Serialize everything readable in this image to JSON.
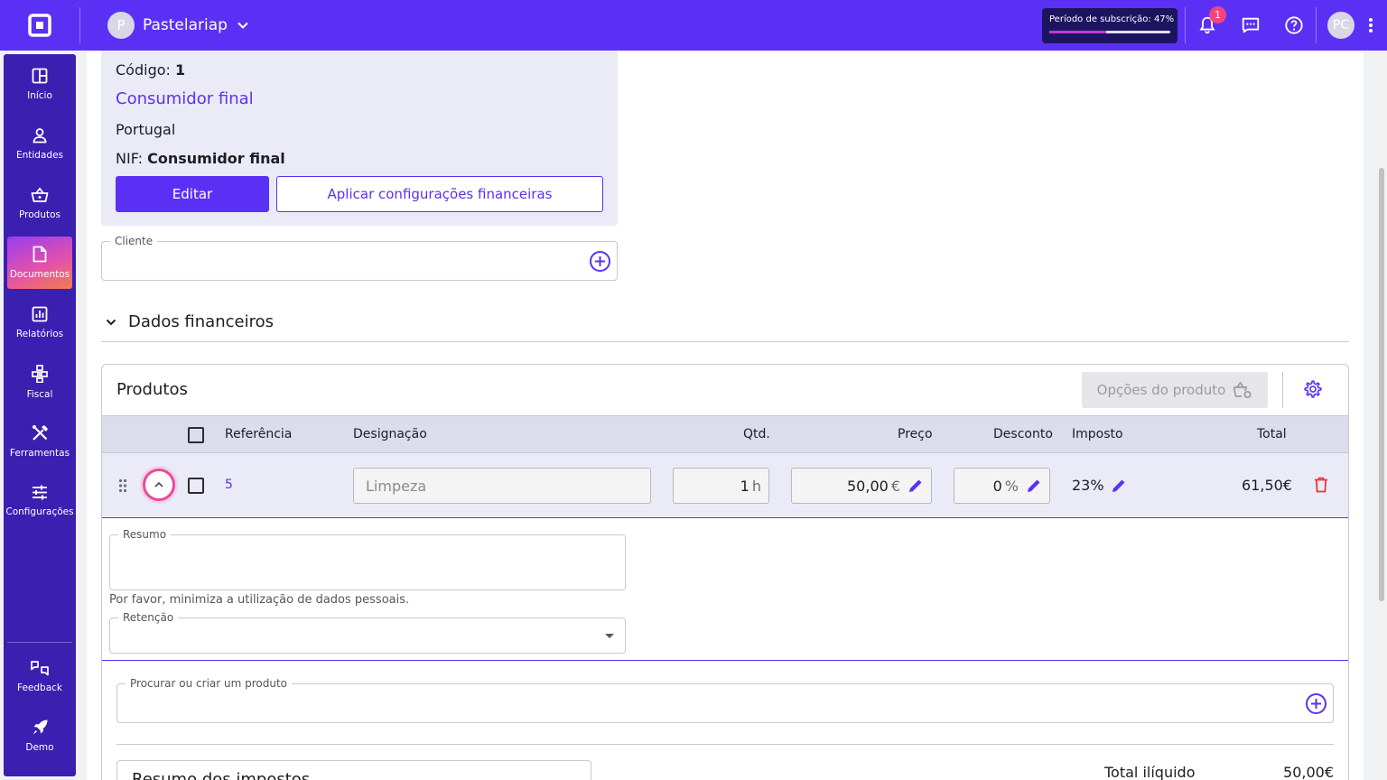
{
  "company": {
    "avatar_letter": "P",
    "name": "Pastelariap"
  },
  "subscription": {
    "label": "Período de subscrição: 47%",
    "progress": 0.47
  },
  "notifications": {
    "count": "1"
  },
  "user": {
    "initials": "PC"
  },
  "sidebar": {
    "items": [
      {
        "label": "Início",
        "icon": "grid-icon"
      },
      {
        "label": "Entidades",
        "icon": "person-icon"
      },
      {
        "label": "Produtos",
        "icon": "basket-icon"
      },
      {
        "label": "Documentos",
        "icon": "document-icon",
        "active": true
      },
      {
        "label": "Relatórios",
        "icon": "chart-icon"
      },
      {
        "label": "Fiscal",
        "icon": "hierarchy-icon"
      },
      {
        "label": "Ferramentas",
        "icon": "tools-icon"
      },
      {
        "label": "Configurações",
        "icon": "sliders-icon"
      }
    ],
    "bottom": [
      {
        "label": "Feedback",
        "icon": "feedback-icon"
      },
      {
        "label": "Demo",
        "icon": "rocket-icon"
      }
    ]
  },
  "client": {
    "code_label": "Código:",
    "code_value": "1",
    "name": "Consumidor final",
    "country": "Portugal",
    "nif_label": "NIF:",
    "nif_value": "Consumidor final",
    "edit_label": "Editar",
    "apply_label": "Aplicar configurações financeiras"
  },
  "client_field": {
    "legend": "Cliente",
    "value": ""
  },
  "financial_section": {
    "title": "Dados financeiros"
  },
  "products": {
    "title": "Produtos",
    "options_label": "Opções do produto",
    "columns": [
      "Referência",
      "Designação",
      "Qtd.",
      "Preço",
      "Desconto",
      "Imposto",
      "Total"
    ],
    "rows": [
      {
        "reference": "5",
        "designation_placeholder": "Limpeza",
        "qty": "1",
        "qty_unit": "h",
        "price": "50,00",
        "price_unit": "€",
        "discount": "0",
        "discount_unit": "%",
        "tax": "23%",
        "total": "61,50€"
      }
    ],
    "summary_legend": "Resumo",
    "privacy_hint": "Por favor, minimiza a utilização de dados pessoais.",
    "retention_legend": "Retenção",
    "search_legend": "Procurar ou criar um produto"
  },
  "totals": {
    "tax_summary_title": "Resumo dos impostos",
    "net_total_label": "Total ilíquido",
    "net_total_value": "50,00€"
  },
  "colors": {
    "primary": "#5a31f4",
    "sidebar": "#3a1fb1",
    "danger": "#e53935",
    "highlight": "#ec4899"
  }
}
